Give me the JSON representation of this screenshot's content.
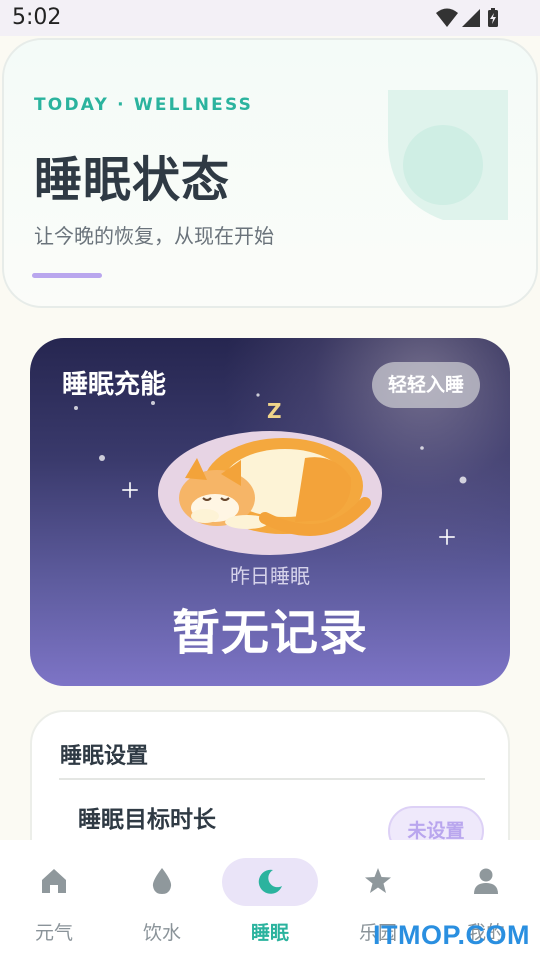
{
  "status_bar": {
    "time": "5:02"
  },
  "hero": {
    "eyebrow": "TODAY · WELLNESS",
    "title": "睡眠状态",
    "subtitle": "让今晚的恢复，从现在开始"
  },
  "sleep_card": {
    "title": "睡眠充能",
    "gentle_button": "轻轻入睡",
    "yesterday_label": "昨日睡眠",
    "yesterday_value": "暂无记录",
    "z_letter": "Z"
  },
  "settings": {
    "title": "睡眠设置",
    "row_label": "睡眠目标时长",
    "row_value": "未设置"
  },
  "nav": {
    "items": [
      {
        "label": "元气",
        "icon": "home-icon"
      },
      {
        "label": "饮水",
        "icon": "water-drop-icon"
      },
      {
        "label": "睡眠",
        "icon": "moon-icon",
        "active": true
      },
      {
        "label": "乐园",
        "icon": "star-icon"
      },
      {
        "label": "我的",
        "icon": "person-icon"
      }
    ]
  },
  "watermark": "ITMOP.COM",
  "colors": {
    "accent_teal": "#2bb39e",
    "accent_purple": "#b9a6ee",
    "night_top": "#262650",
    "night_bottom": "#7d74c6"
  }
}
